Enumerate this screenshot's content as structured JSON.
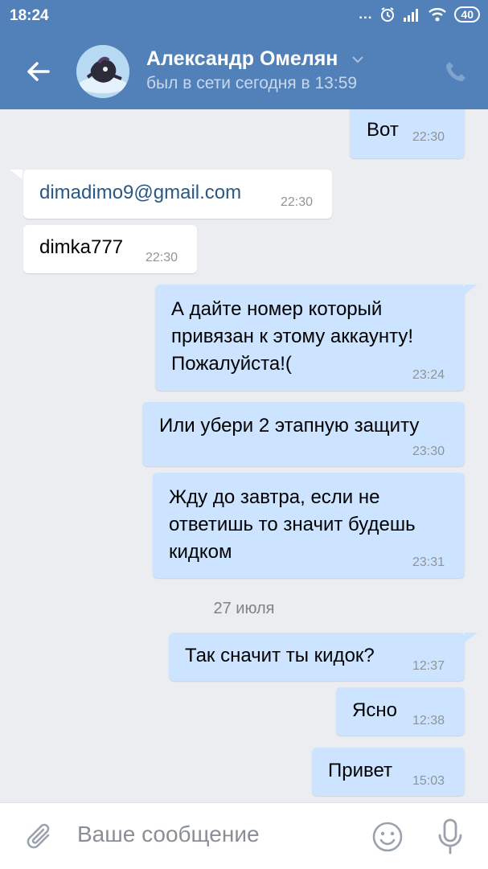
{
  "status_bar": {
    "time": "18:24",
    "dots": "...",
    "battery": "40"
  },
  "header": {
    "name": "Александр Омелян",
    "status": "был в сети сегодня в 13:59"
  },
  "messages": [
    {
      "dir": "out",
      "text": "Вот",
      "time": "22:30"
    },
    {
      "dir": "in",
      "text": "dimadimo9@gmail.com",
      "time": "22:30",
      "is_link": true
    },
    {
      "dir": "in",
      "text": "dimka777",
      "time": "22:30"
    },
    {
      "dir": "out",
      "text": "А дайте номер который\nпривязан к этому аккаунту!\nПожалуйста!(",
      "time": "23:24"
    },
    {
      "dir": "out",
      "text": "Или убери 2 этапную защиту",
      "time": "23:30"
    },
    {
      "dir": "out",
      "text": "Жду до завтра, если не\nответишь то значит будешь\nкидком",
      "time": "23:31"
    },
    {
      "dir": "out",
      "text": "Так сначит ты кидок?",
      "time": "12:37"
    },
    {
      "dir": "out",
      "text": "Ясно",
      "time": "12:38"
    },
    {
      "dir": "out",
      "text": "Привет",
      "time": "15:03"
    }
  ],
  "date_separator": "27 июля",
  "composer": {
    "placeholder": "Ваше сообщение"
  },
  "colors": {
    "header": "#5181b8",
    "outgoing_bubble": "#cce4ff",
    "incoming_bubble": "#ffffff",
    "background": "#ebedf0"
  },
  "icons": [
    "back-arrow-icon",
    "chevron-down-icon",
    "phone-icon",
    "paperclip-icon",
    "emoji-icon",
    "microphone-icon",
    "alarm-icon",
    "signal-icon",
    "wifi-icon"
  ]
}
